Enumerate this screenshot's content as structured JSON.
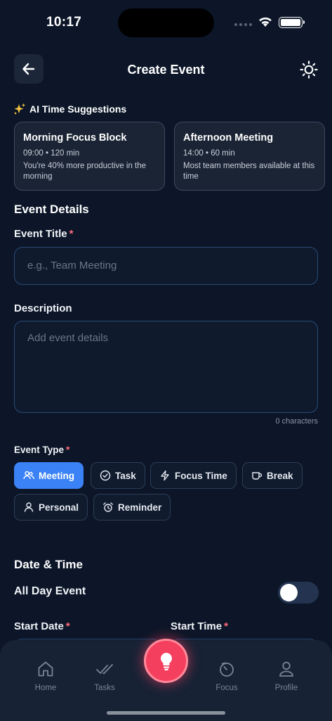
{
  "status": {
    "time": "10:17"
  },
  "header": {
    "title": "Create Event",
    "back_icon": "arrow-left-icon",
    "theme_icon": "sun-icon"
  },
  "ai": {
    "heading": "AI Time Suggestions",
    "cards": [
      {
        "title": "Morning Focus Block",
        "meta": "09:00 • 120 min",
        "desc": "You're 40% more productive in the morning"
      },
      {
        "title": "Afternoon Meeting",
        "meta": "14:00 • 60 min",
        "desc": "Most team members available at this time"
      }
    ]
  },
  "details": {
    "section_title": "Event Details",
    "title_label": "Event Title",
    "title_placeholder": "e.g., Team Meeting",
    "description_label": "Description",
    "description_placeholder": "Add event details",
    "char_count": "0 characters"
  },
  "required_mark": "*",
  "event_type": {
    "label": "Event Type",
    "options": [
      {
        "label": "Meeting",
        "icon": "users-icon",
        "selected": true
      },
      {
        "label": "Task",
        "icon": "check-circle-icon",
        "selected": false
      },
      {
        "label": "Focus Time",
        "icon": "lightning-icon",
        "selected": false
      },
      {
        "label": "Break",
        "icon": "coffee-icon",
        "selected": false
      },
      {
        "label": "Personal",
        "icon": "user-icon",
        "selected": false
      },
      {
        "label": "Reminder",
        "icon": "alarm-icon",
        "selected": false
      }
    ]
  },
  "datetime": {
    "section_title": "Date & Time",
    "all_day_label": "All Day Event",
    "all_day_on": false,
    "start_date_label": "Start Date",
    "start_time_label": "Start Time"
  },
  "tabbar": {
    "items": [
      {
        "label": "Home",
        "icon": "home-icon"
      },
      {
        "label": "Tasks",
        "icon": "double-check-icon"
      },
      {
        "label": "Focus",
        "icon": "timer-icon"
      },
      {
        "label": "Profile",
        "icon": "profile-icon"
      }
    ],
    "fab_icon": "lightbulb-icon"
  },
  "colors": {
    "background": "#0c1628",
    "accent": "#3b82f6",
    "fab": "#f43f5e",
    "required": "#ff6b7a"
  }
}
